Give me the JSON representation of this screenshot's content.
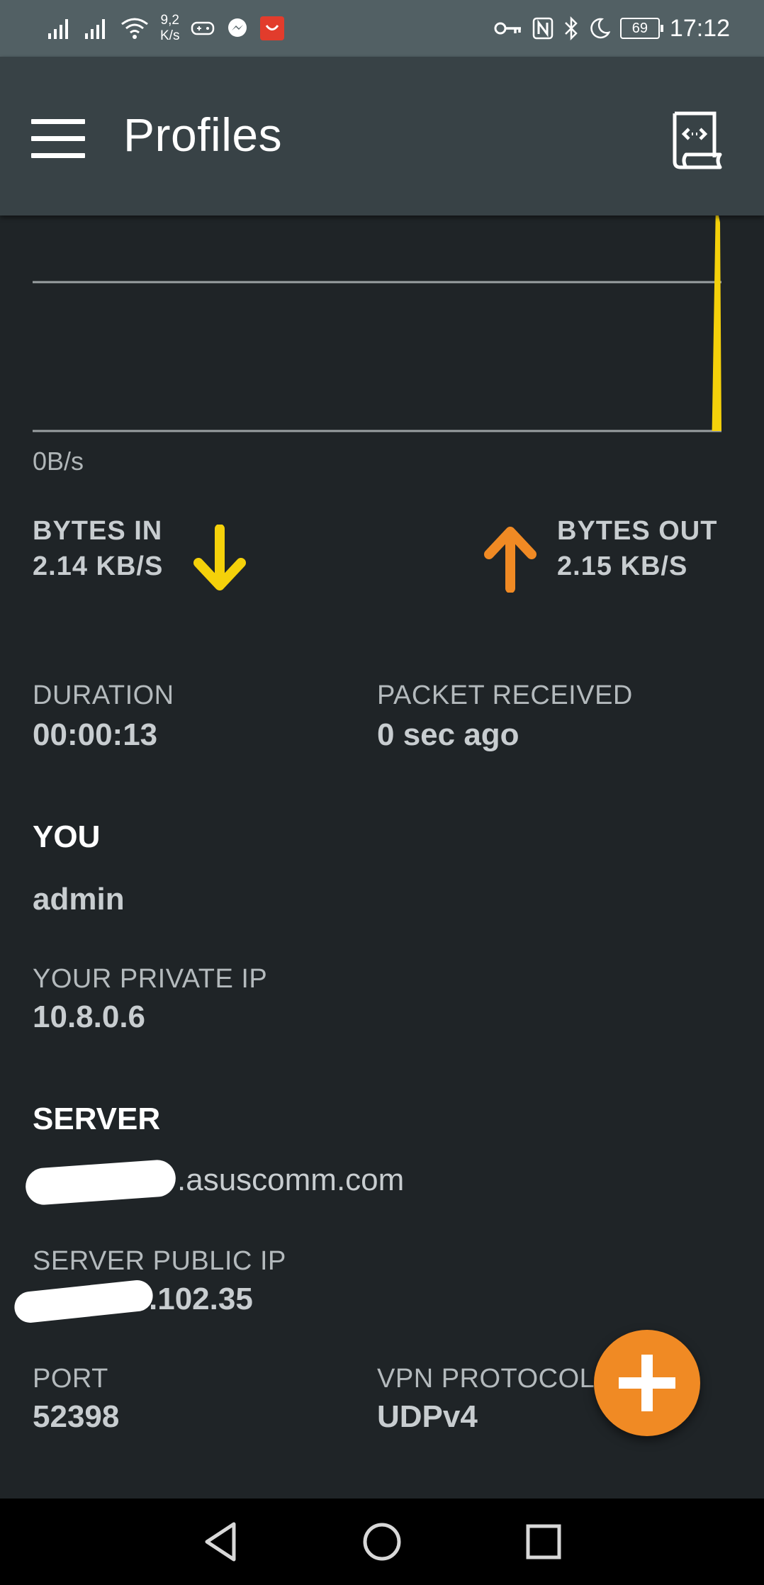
{
  "status_bar": {
    "net_speed_value": "9,2",
    "net_speed_unit": "K/s",
    "battery": "69",
    "time": "17:12",
    "left_icons": [
      "signal-icon",
      "signal-icon",
      "wifi-icon",
      "gamepad-icon",
      "messenger-icon",
      "app-notification-icon"
    ],
    "right_icons": [
      "vpn-key-icon",
      "nfc-icon",
      "bluetooth-icon",
      "do-not-disturb-moon-icon",
      "battery-icon"
    ]
  },
  "app_bar": {
    "title": "Profiles",
    "menu_icon": "hamburger-menu-icon",
    "action_icon": "log-scroll-icon"
  },
  "graph": {
    "axis_label": "0B/s"
  },
  "chart_data": {
    "type": "area",
    "title": "",
    "xlabel": "",
    "ylabel": "",
    "series": [
      {
        "values": [
          0,
          0,
          0,
          0,
          0,
          0,
          0,
          0,
          0,
          0,
          0,
          0,
          0,
          0,
          0,
          0,
          0,
          0,
          0,
          0,
          0,
          0,
          0,
          0,
          0,
          0,
          0,
          0,
          0,
          1.0
        ],
        "color": "#f5d10a"
      }
    ],
    "y_tick_labels": [
      "0B/s"
    ],
    "grid": true
  },
  "traffic": {
    "bytes_in_label": "BYTES IN",
    "bytes_in_value": "2.14 KB/S",
    "bytes_in_color": "#f5d10a",
    "bytes_out_label": "BYTES OUT",
    "bytes_out_value": "2.15 KB/S",
    "bytes_out_color": "#f08a24"
  },
  "connection": {
    "duration_label": "DURATION",
    "duration_value": "00:00:13",
    "packet_label": "PACKET RECEIVED",
    "packet_value": "0 sec ago"
  },
  "you": {
    "section_title": "YOU",
    "username": "admin",
    "private_ip_label": "YOUR PRIVATE IP",
    "private_ip_value": "10.8.0.6"
  },
  "server": {
    "section_title": "SERVER",
    "hostname_visible": ".asuscomm.com",
    "public_ip_label": "SERVER PUBLIC IP",
    "public_ip_visible": ".102.35",
    "port_label": "PORT",
    "port_value": "52398",
    "protocol_label": "VPN PROTOCOL",
    "protocol_value": "UDPv4"
  },
  "fab": {
    "icon": "plus-icon",
    "color": "#f08a24"
  },
  "nav_bar": {
    "icons": [
      "back-triangle-icon",
      "home-circle-icon",
      "recents-square-icon"
    ]
  }
}
